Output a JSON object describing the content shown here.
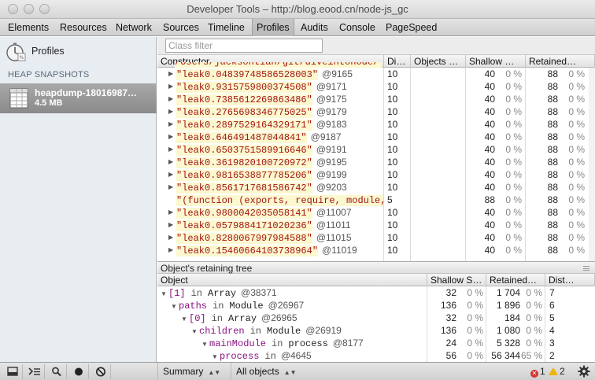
{
  "window": {
    "title": "Developer Tools – http://blog.eood.cn/node-js_gc"
  },
  "tabs": [
    {
      "label": "Elements"
    },
    {
      "label": "Resources"
    },
    {
      "label": "Network"
    },
    {
      "label": "Sources"
    },
    {
      "label": "Timeline"
    },
    {
      "label": "Profiles"
    },
    {
      "label": "Audits"
    },
    {
      "label": "Console"
    },
    {
      "label": "PageSpeed"
    }
  ],
  "active_tab": "Profiles",
  "sidebar": {
    "profiles_label": "Profiles",
    "heap_header": "HEAP SNAPSHOTS",
    "snapshot": {
      "name": "heapdump-18016987…",
      "size": "4.5 MB"
    }
  },
  "filter": {
    "placeholder": "Class filter",
    "value": ""
  },
  "constructors": {
    "columns": [
      "Constructor",
      "Di…",
      "Objects …",
      "Shallow …",
      "Retained…"
    ],
    "top_partial_text": "/Users/jacksontian/git/diveintonode/",
    "rows": [
      {
        "label": "\"leak0.04839748586528003\"",
        "id": "@9165",
        "dist": "10",
        "shallow": "40",
        "shallow_pct": "0 %",
        "retained": "88",
        "retained_pct": "0 %"
      },
      {
        "label": "\"leak0.9315759800374508\"",
        "id": "@9171",
        "dist": "10",
        "shallow": "40",
        "shallow_pct": "0 %",
        "retained": "88",
        "retained_pct": "0 %"
      },
      {
        "label": "\"leak0.7385612269863486\"",
        "id": "@9175",
        "dist": "10",
        "shallow": "40",
        "shallow_pct": "0 %",
        "retained": "88",
        "retained_pct": "0 %"
      },
      {
        "label": "\"leak0.2765698346775025\"",
        "id": "@9179",
        "dist": "10",
        "shallow": "40",
        "shallow_pct": "0 %",
        "retained": "88",
        "retained_pct": "0 %"
      },
      {
        "label": "\"leak0.2897529164329171\"",
        "id": "@9183",
        "dist": "10",
        "shallow": "40",
        "shallow_pct": "0 %",
        "retained": "88",
        "retained_pct": "0 %"
      },
      {
        "label": "\"leak0.646491487044841\"",
        "id": "@9187",
        "dist": "10",
        "shallow": "40",
        "shallow_pct": "0 %",
        "retained": "88",
        "retained_pct": "0 %"
      },
      {
        "label": "\"leak0.6503751589916646\"",
        "id": "@9191",
        "dist": "10",
        "shallow": "40",
        "shallow_pct": "0 %",
        "retained": "88",
        "retained_pct": "0 %"
      },
      {
        "label": "\"leak0.3619820100720972\"",
        "id": "@9195",
        "dist": "10",
        "shallow": "40",
        "shallow_pct": "0 %",
        "retained": "88",
        "retained_pct": "0 %"
      },
      {
        "label": "\"leak0.9816538877785206\"",
        "id": "@9199",
        "dist": "10",
        "shallow": "40",
        "shallow_pct": "0 %",
        "retained": "88",
        "retained_pct": "0 %"
      },
      {
        "label": "\"leak0.8561717681586742\"",
        "id": "@9203",
        "dist": "10",
        "shallow": "40",
        "shallow_pct": "0 %",
        "retained": "88",
        "retained_pct": "0 %"
      },
      {
        "label": "\"(function (exports, require, module,",
        "id": "",
        "dist": "5",
        "shallow": "88",
        "shallow_pct": "0 %",
        "retained": "88",
        "retained_pct": "0 %"
      },
      {
        "label": "\"leak0.9800042035058141\"",
        "id": "@11007",
        "dist": "10",
        "shallow": "40",
        "shallow_pct": "0 %",
        "retained": "88",
        "retained_pct": "0 %"
      },
      {
        "label": "\"leak0.0579884171020236\"",
        "id": "@11011",
        "dist": "10",
        "shallow": "40",
        "shallow_pct": "0 %",
        "retained": "88",
        "retained_pct": "0 %"
      },
      {
        "label": "\"leak0.8280067997984588\"",
        "id": "@11015",
        "dist": "10",
        "shallow": "40",
        "shallow_pct": "0 %",
        "retained": "88",
        "retained_pct": "0 %"
      },
      {
        "label": "\"leak0.15460664103738964\"",
        "id": "@11019",
        "dist": "10",
        "shallow": "40",
        "shallow_pct": "0 %",
        "retained": "88",
        "retained_pct": "0 %"
      }
    ]
  },
  "retaining_tree": {
    "title": "Object's retaining tree",
    "columns": [
      "Object",
      "Shallow S…",
      "Retained…",
      "Dist…"
    ],
    "rows": [
      {
        "level": 0,
        "prop": "[1]",
        "ctor": "Array",
        "id": "@38371",
        "shallow": "32",
        "shallow_pct": "0 %",
        "retained": "1 704",
        "retained_pct": "0 %",
        "dist": "7"
      },
      {
        "level": 1,
        "prop": "paths",
        "ctor": "Module",
        "id": "@26967",
        "shallow": "136",
        "shallow_pct": "0 %",
        "retained": "1 896",
        "retained_pct": "0 %",
        "dist": "6"
      },
      {
        "level": 2,
        "prop": "[0]",
        "ctor": "Array",
        "id": "@26965",
        "shallow": "32",
        "shallow_pct": "0 %",
        "retained": "184",
        "retained_pct": "0 %",
        "dist": "5"
      },
      {
        "level": 3,
        "prop": "children",
        "ctor": "Module",
        "id": "@26919",
        "shallow": "136",
        "shallow_pct": "0 %",
        "retained": "1 080",
        "retained_pct": "0 %",
        "dist": "4"
      },
      {
        "level": 4,
        "prop": "mainModule",
        "ctor": "process",
        "id": "@8177",
        "shallow": "24",
        "shallow_pct": "0 %",
        "retained": "5 328",
        "retained_pct": "0 %",
        "dist": "3"
      },
      {
        "level": 5,
        "prop": "process",
        "ctor": "",
        "id": "@4645",
        "shallow": "56",
        "shallow_pct": "0 %",
        "retained": "56 344",
        "retained_pct": "65 %",
        "dist": "2"
      }
    ],
    "in_word": "in"
  },
  "statusbar": {
    "summary_label": "Summary",
    "objects_label": "All objects",
    "errors": "1",
    "warnings": "2"
  }
}
